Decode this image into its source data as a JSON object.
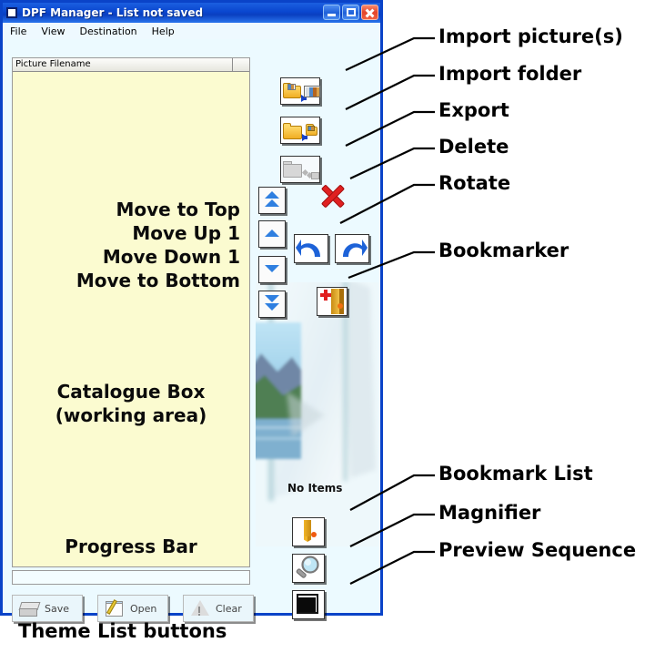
{
  "window": {
    "title": "DPF Manager  -  List not saved",
    "menu": [
      "File",
      "View",
      "Destination",
      "Help"
    ],
    "buttons": {
      "minimize": "Minimize",
      "maximize": "Maximize",
      "close": "Close"
    }
  },
  "list": {
    "column_header": "Picture Filename",
    "column_header_2": "",
    "annotations": {
      "move_top": "Move to Top",
      "move_up": "Move Up 1",
      "move_down": "Move Down 1",
      "move_bottom": "Move to Bottom",
      "catalogue_line1": "Catalogue Box",
      "catalogue_line2": "(working area)",
      "progress": "Progress Bar"
    }
  },
  "theme_buttons": [
    {
      "label": "Save",
      "icon": "scanner-icon"
    },
    {
      "label": "Open",
      "icon": "notepad-pencil-icon"
    },
    {
      "label": "Clear",
      "icon": "warning-triangle-icon"
    }
  ],
  "preview": {
    "empty_text": "No Items"
  },
  "toolbar_icons": [
    {
      "name": "import-pictures-icon"
    },
    {
      "name": "import-folder-icon"
    },
    {
      "name": "export-icon"
    },
    {
      "name": "delete-icon"
    },
    {
      "name": "rotate-left-icon"
    },
    {
      "name": "rotate-right-icon"
    },
    {
      "name": "bookmarker-icon"
    },
    {
      "name": "move-to-top-icon"
    },
    {
      "name": "move-up-icon"
    },
    {
      "name": "move-down-icon"
    },
    {
      "name": "move-to-bottom-icon"
    },
    {
      "name": "bookmark-list-icon"
    },
    {
      "name": "magnifier-icon"
    },
    {
      "name": "preview-sequence-icon"
    }
  ],
  "callouts": {
    "import_pictures": "Import picture(s)",
    "import_folder": "Import folder",
    "export": "Export",
    "delete": "Delete",
    "rotate": "Rotate",
    "bookmarker": "Bookmarker",
    "bookmark_list": "Bookmark List",
    "magnifier": "Magnifier",
    "preview_sequence": "Preview Sequence"
  },
  "caption": {
    "theme_list": "Theme List buttons"
  },
  "colors": {
    "title_blue": "#0a43c8",
    "list_yellow": "#fbfbd0",
    "client_bg": "#ecfaff",
    "close_red": "#e3442a",
    "accent_orange": "#f0ae23",
    "delete_red": "#e02020",
    "arrow_blue": "#2f7fe0"
  }
}
